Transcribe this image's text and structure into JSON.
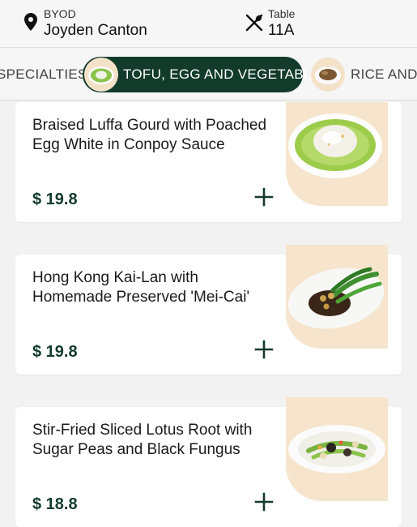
{
  "header": {
    "location_label": "BYOD",
    "location_name": "Joyden Canton",
    "location_icon": "location-pin-icon",
    "table_label": "Table",
    "table_number": "11A",
    "table_icon": "fork-spoon-icon"
  },
  "categories": {
    "items": [
      {
        "label": "SPECIALTIES",
        "active": false
      },
      {
        "label": "TOFU, EGG AND VEGETABLE",
        "active": true
      },
      {
        "label": "RICE AND NOODLES",
        "active": false
      }
    ]
  },
  "dishes": [
    {
      "name": "Braised Luffa Gourd with Poached Egg White in Conpoy Sauce",
      "price": "$ 19.8",
      "add_icon": "plus-icon"
    },
    {
      "name": "Hong Kong Kai-Lan with Homemade Preserved 'Mei-Cai'",
      "price": "$ 19.8",
      "add_icon": "plus-icon"
    },
    {
      "name": "Stir-Fried Sliced Lotus Root with Sugar Peas and Black Fungus",
      "price": "$ 18.8",
      "add_icon": "plus-icon"
    }
  ],
  "colors": {
    "accent": "#123b2c",
    "image_bg": "#f6e5cc",
    "page_bg": "#f2f2f2"
  }
}
